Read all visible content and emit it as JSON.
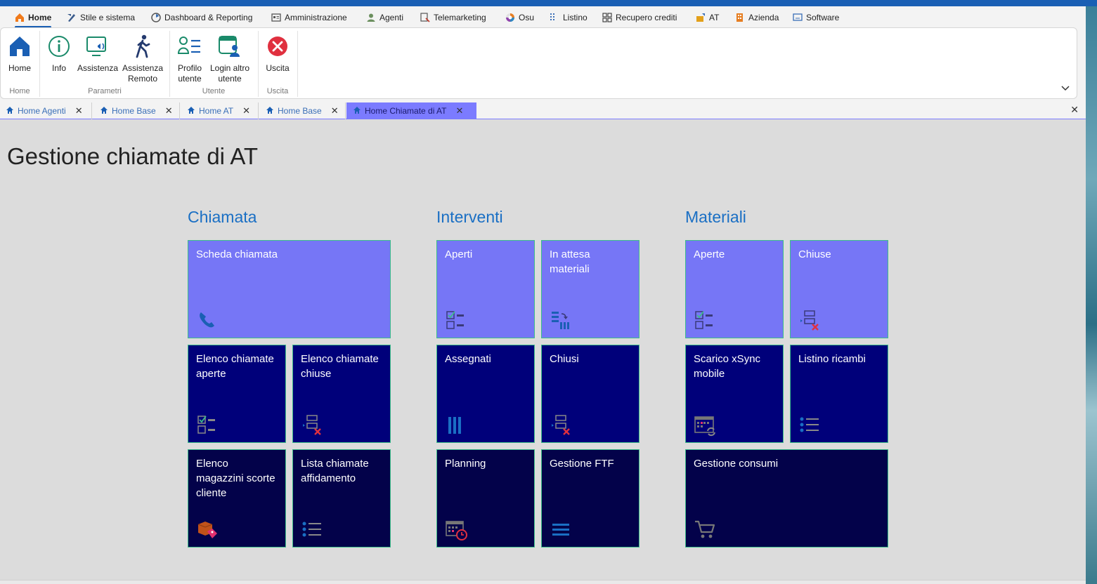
{
  "menu": {
    "items": [
      {
        "label": "Home",
        "icon": "home-icon",
        "active": true
      },
      {
        "label": "Stile e sistema",
        "icon": "style-icon"
      },
      {
        "label": "Dashboard & Reporting",
        "icon": "dashboard-icon"
      },
      {
        "label": "Amministrazione",
        "icon": "admin-icon"
      },
      {
        "label": "Agenti",
        "icon": "agent-icon"
      },
      {
        "label": "Telemarketing",
        "icon": "telemarketing-icon"
      },
      {
        "label": "Osu",
        "icon": "osu-icon"
      },
      {
        "label": "Listino",
        "icon": "listino-icon"
      },
      {
        "label": "Recupero crediti",
        "icon": "grid-icon"
      },
      {
        "label": "AT",
        "icon": "at-icon"
      },
      {
        "label": "Azienda",
        "icon": "building-icon"
      },
      {
        "label": "Software",
        "icon": "monitor-icon"
      }
    ]
  },
  "ribbon": {
    "home_label": "Home",
    "info_label": "Info",
    "assistenza_label": "Assistenza",
    "assistenza_remoto_line1": "Assistenza",
    "assistenza_remoto_line2": "Remoto",
    "profilo_line1": "Profilo",
    "profilo_line2": "utente",
    "login_line1": "Login altro",
    "login_line2": "utente",
    "uscita_label": "Uscita",
    "groups": {
      "home": "Home",
      "parametri": "Parametri",
      "utente": "Utente",
      "uscita": "Uscita"
    }
  },
  "tabs": [
    {
      "label": "Home Agenti"
    },
    {
      "label": "Home Base"
    },
    {
      "label": "Home AT"
    },
    {
      "label": "Home Base"
    },
    {
      "label": "Home Chiamate di AT",
      "active": true
    }
  ],
  "page": {
    "title": "Gestione chiamate di AT"
  },
  "sections": {
    "chiamata": {
      "title": "Chiamata",
      "tiles": {
        "scheda": "Scheda chiamata",
        "elenco_aperte": "Elenco chiamate aperte",
        "elenco_chiuse": "Elenco chiamate chiuse",
        "magazzini": "Elenco magazzini scorte cliente",
        "affidamento": "Lista chiamate affidamento"
      }
    },
    "interventi": {
      "title": "Interventi",
      "tiles": {
        "aperti": "Aperti",
        "attesa": "In attesa materiali",
        "assegnati": "Assegnati",
        "chiusi": "Chiusi",
        "planning": "Planning",
        "ftf": "Gestione FTF"
      }
    },
    "materiali": {
      "title": "Materiali",
      "tiles": {
        "aperte": "Aperte",
        "chiuse": "Chiuse",
        "xsync": "Scarico xSync mobile",
        "ricambi": "Listino ricambi",
        "consumi": "Gestione consumi"
      }
    }
  },
  "colors": {
    "tile_light": "#7676f6",
    "tile_mid": "#00007a",
    "tile_dark": "#03024a",
    "accent": "#1a6fc4",
    "tile_border": "#3dbd8a"
  }
}
